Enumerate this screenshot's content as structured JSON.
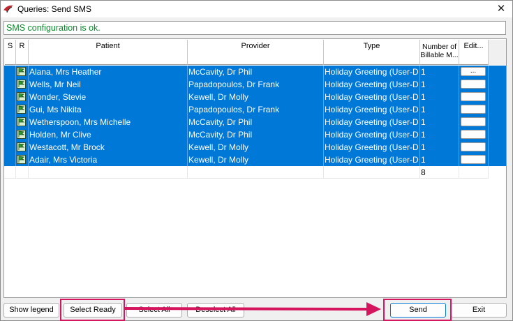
{
  "window": {
    "title": "Queries: Send SMS",
    "close_glyph": "✕",
    "app_icon": "red-leaf-app-icon"
  },
  "status": {
    "text": "SMS configuration is ok.",
    "color": "#0a8a2a"
  },
  "grid": {
    "columns": {
      "s": "S",
      "r": "R",
      "patient": "Patient",
      "provider": "Provider",
      "type": "Type",
      "billable": "Number of Billable M...",
      "edit": "Edit..."
    },
    "rows": [
      {
        "patient": "Alana, Mrs Heather",
        "provider": "McCavity, Dr Phil",
        "type": "Holiday Greeting (User-D",
        "billable": "1",
        "edit": "..."
      },
      {
        "patient": "Wells, Mr Neil",
        "provider": "Papadopoulos, Dr Frank",
        "type": "Holiday Greeting (User-D",
        "billable": "1",
        "edit": ""
      },
      {
        "patient": "Wonder,  Stevie",
        "provider": "Kewell, Dr Molly",
        "type": "Holiday Greeting (User-D",
        "billable": "1",
        "edit": ""
      },
      {
        "patient": "Gui, Ms Nikita",
        "provider": "Papadopoulos, Dr Frank",
        "type": "Holiday Greeting (User-D",
        "billable": "1",
        "edit": ""
      },
      {
        "patient": "Wetherspoon, Mrs Michelle",
        "provider": "McCavity, Dr Phil",
        "type": "Holiday Greeting (User-D",
        "billable": "1",
        "edit": ""
      },
      {
        "patient": "Holden, Mr Clive",
        "provider": "McCavity, Dr Phil",
        "type": "Holiday Greeting (User-D",
        "billable": "1",
        "edit": ""
      },
      {
        "patient": "Westacott, Mr Brock",
        "provider": "Kewell, Dr Molly",
        "type": "Holiday Greeting (User-D",
        "billable": "1",
        "edit": ""
      },
      {
        "patient": "Adair, Mrs Victoria",
        "provider": "Kewell, Dr Molly",
        "type": "Holiday Greeting (User-D",
        "billable": "1",
        "edit": ""
      }
    ],
    "total": "8",
    "selection_color": "#0078d7"
  },
  "buttons": {
    "show_legend": "Show legend",
    "select_ready": "Select Ready",
    "select_all": "Select All",
    "deselect_all": "Deselect All",
    "send": "Send",
    "exit": "Exit"
  },
  "annotation": {
    "color": "#d6155f"
  }
}
